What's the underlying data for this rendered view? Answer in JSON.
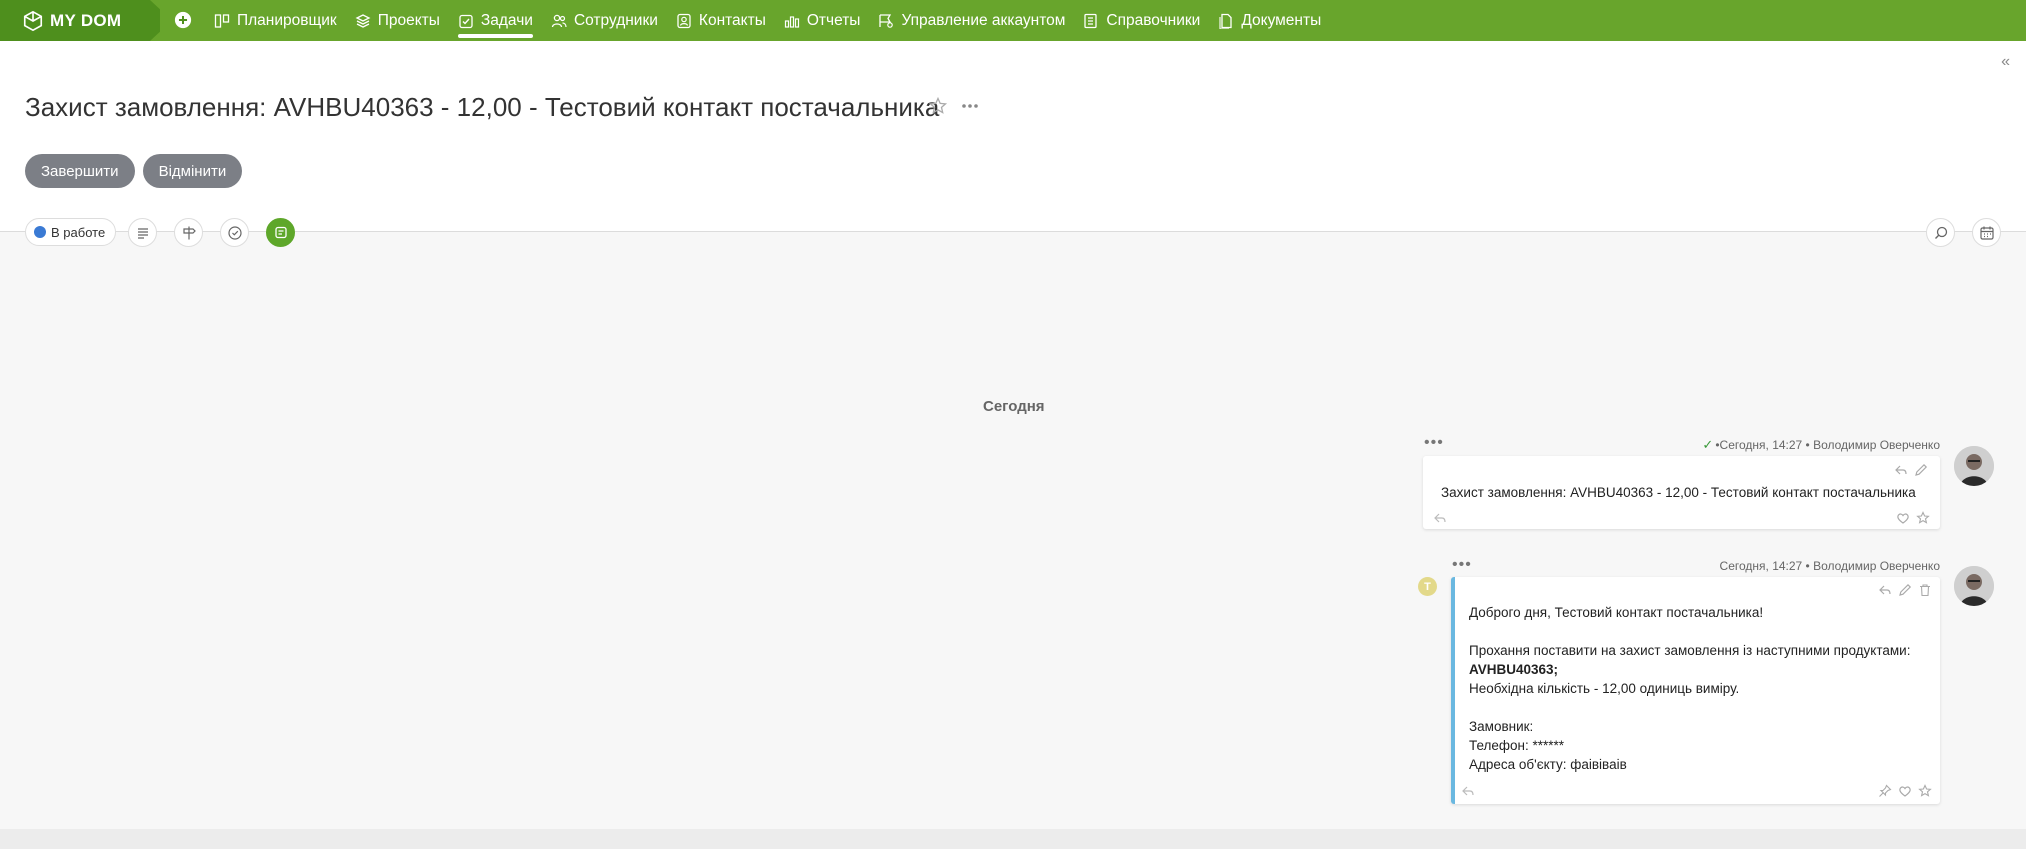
{
  "app": {
    "logo": "MY DOM"
  },
  "nav": {
    "items": [
      {
        "label": "Планировщик",
        "icon": "planner-icon"
      },
      {
        "label": "Проекты",
        "icon": "projects-icon"
      },
      {
        "label": "Задачи",
        "icon": "tasks-icon",
        "active": true
      },
      {
        "label": "Сотрудники",
        "icon": "employees-icon"
      },
      {
        "label": "Контакты",
        "icon": "contacts-icon"
      },
      {
        "label": "Отчеты",
        "icon": "reports-icon"
      },
      {
        "label": "Управление аккаунтом",
        "icon": "account-icon"
      },
      {
        "label": "Справочники",
        "icon": "directories-icon"
      },
      {
        "label": "Документы",
        "icon": "documents-icon"
      }
    ]
  },
  "task": {
    "title": "Захист замовлення: AVHBU40363 - 12,00 - Тестовий контакт постачальника",
    "complete_label": "Завершити",
    "cancel_label": "Відмінити",
    "status": "В работе"
  },
  "chat": {
    "day_label": "Сегодня",
    "messages": [
      {
        "meta_time": "Сегодня, 14:27",
        "author": "Володимир Оверченко",
        "text": "Захист замовлення: AVHBU40363 - 12,00 - Тестовий контакт постачальника"
      },
      {
        "meta_time": "Сегодня, 14:27",
        "author": "Володимир Оверченко",
        "badge": "T",
        "lines": {
          "greeting": "Доброго дня, Тестовий контакт постачальника!",
          "request": "Прохання поставити на захист замовлення із наступними продуктами:",
          "product": "AVHBU40363;",
          "quantity": "Необхідна кількість - 12,00 одиниць виміру.",
          "customer": "Замовник:",
          "phone": "Телефон: ******",
          "address": "Адреса об'єкту: фаівіваів"
        }
      }
    ]
  },
  "colors": {
    "nav_bg": "#68a52c",
    "logo_bg": "#4e8f1d",
    "accent_bar": "#6ab8e0",
    "status_dot": "#3a7ad4"
  }
}
